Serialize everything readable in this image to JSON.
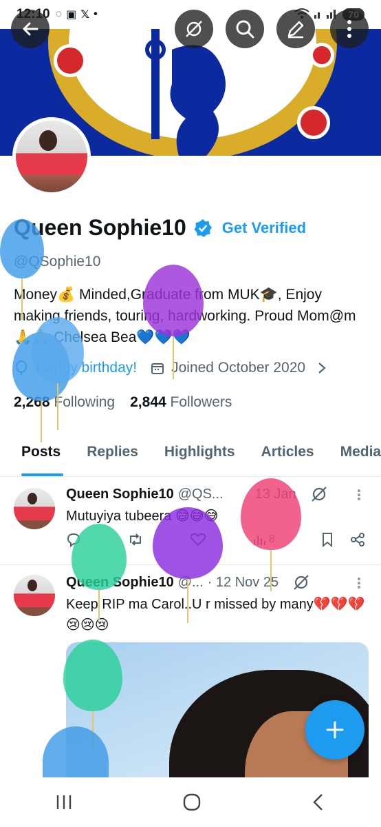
{
  "status_bar": {
    "time": "12:10",
    "battery": "70"
  },
  "profile": {
    "name": "Queen Sophie10",
    "get_verified": "Get Verified",
    "handle": "@QSophie10",
    "bio": "Money💰 Minded,Graduate from MUK🎓,  Enjoy making friends, touring, hardworking. Proud Mom@m 🙏🙏 Chelsea Bea💙💙💙",
    "birthday": "Happy birthday!",
    "joined": "Joined October 2020",
    "following_count": "2,268",
    "following_label": "Following",
    "followers_count": "2,844",
    "followers_label": "Followers"
  },
  "tabs": [
    {
      "label": "Posts"
    },
    {
      "label": "Replies"
    },
    {
      "label": "Highlights"
    },
    {
      "label": "Articles"
    },
    {
      "label": "Media"
    }
  ],
  "posts": [
    {
      "name": "Queen Sophie10",
      "handle": "@QS...",
      "date": "13 Jan",
      "text": "Mutuyiya tubeera 😅😅😅",
      "views": "8"
    },
    {
      "name": "Queen Sophie10",
      "handle": "@...",
      "date": "· 12 Nov 25",
      "text": "Keep RIP ma Carol..U r missed by many💔💔💔😢😢😢"
    }
  ],
  "colors": {
    "accent": "#1d9bf0",
    "banner": "#0c2aa0"
  }
}
